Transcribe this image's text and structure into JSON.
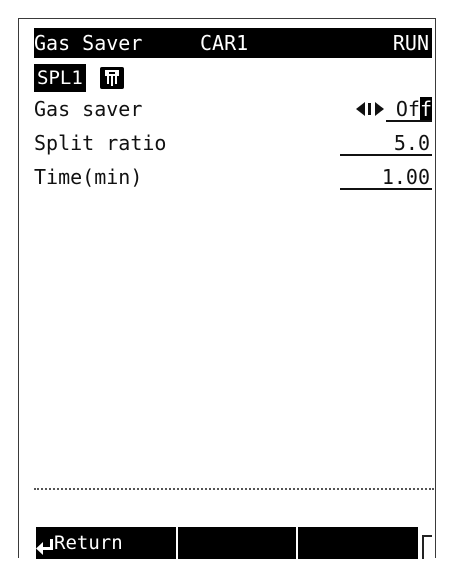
{
  "header": {
    "title": "Gas Saver",
    "carrier": "CAR1",
    "status": "RUN"
  },
  "channel": {
    "label": "SPL1",
    "icon": "injector-icon"
  },
  "params": [
    {
      "label": "Gas saver",
      "value": "Off",
      "control": "left-right-arrows-icon"
    },
    {
      "label": "Split ratio",
      "value": "5.0"
    },
    {
      "label": "Time(min)",
      "value": "1.00"
    }
  ],
  "softkeys": {
    "return_label": "Return",
    "return_icon": "return-arrow-icon"
  }
}
